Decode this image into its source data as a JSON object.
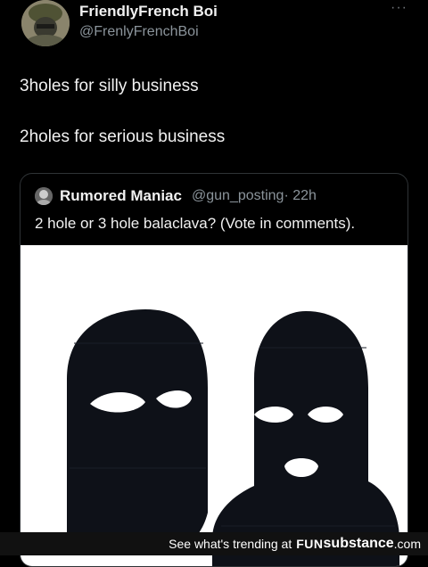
{
  "tweet": {
    "author_name": "FriendlyFrench Boi",
    "author_handle": "@FrenlyFrenchBoi",
    "more_glyph": "···",
    "lines": [
      "3holes for silly business",
      "2holes for serious business"
    ]
  },
  "quoted_tweet": {
    "author_name": "Rumored Maniac",
    "author_handle": "@gun_posting",
    "time": "· 22h",
    "text": "2 hole or 3 hole balaclava? (Vote in comments)."
  },
  "footer": {
    "text": "See what's trending at",
    "brand_prefix": "FUN",
    "brand_suffix": "substance",
    "brand_tld": ".com"
  },
  "colors": {
    "background": "#000000",
    "secondary_text": "#8b949b",
    "border": "#2f3336"
  }
}
